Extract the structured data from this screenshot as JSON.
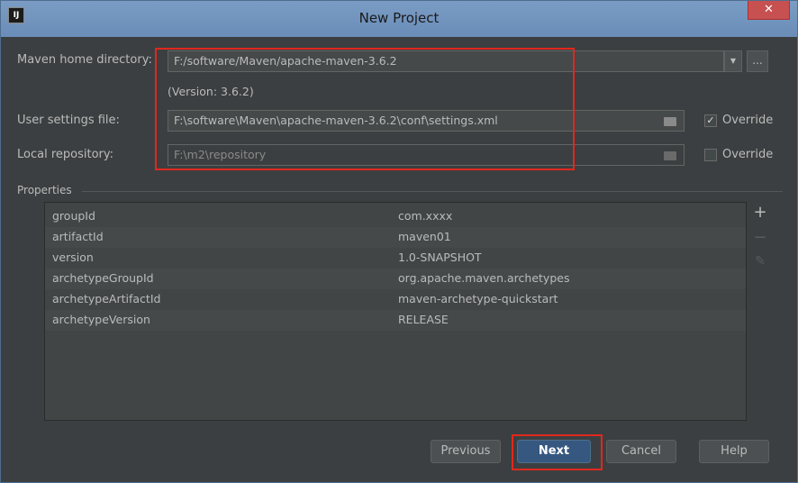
{
  "window": {
    "title": "New Project",
    "app_icon_text": "IJ",
    "close_glyph": "✕"
  },
  "form": {
    "maven_home": {
      "label": "Maven home directory:",
      "value": "F:/software/Maven/apache-maven-3.6.2",
      "dropdown_glyph": "▼",
      "browse_label": "..."
    },
    "version_text": "(Version: 3.6.2)",
    "user_settings": {
      "label": "User settings file:",
      "value": "F:\\software\\Maven\\apache-maven-3.6.2\\conf\\settings.xml",
      "override_label": "Override",
      "override_checked": true,
      "check_glyph": "✓"
    },
    "local_repo": {
      "label": "Local repository:",
      "value": "F:\\m2\\repository",
      "override_label": "Override",
      "override_checked": false
    }
  },
  "properties": {
    "title": "Properties",
    "rows": [
      {
        "key": "groupId",
        "value": "com.xxxx"
      },
      {
        "key": "artifactId",
        "value": "maven01"
      },
      {
        "key": "version",
        "value": "1.0-SNAPSHOT"
      },
      {
        "key": "archetypeGroupId",
        "value": "org.apache.maven.archetypes"
      },
      {
        "key": "archetypeArtifactId",
        "value": "maven-archetype-quickstart"
      },
      {
        "key": "archetypeVersion",
        "value": "RELEASE"
      }
    ],
    "tools": {
      "add": "+",
      "remove": "−",
      "edit": "✎"
    }
  },
  "buttons": {
    "previous": "Previous",
    "next": "Next",
    "cancel": "Cancel",
    "help": "Help"
  },
  "colors": {
    "highlight": "#e0281e",
    "primary_button": "#365880",
    "background": "#3c3f41"
  }
}
